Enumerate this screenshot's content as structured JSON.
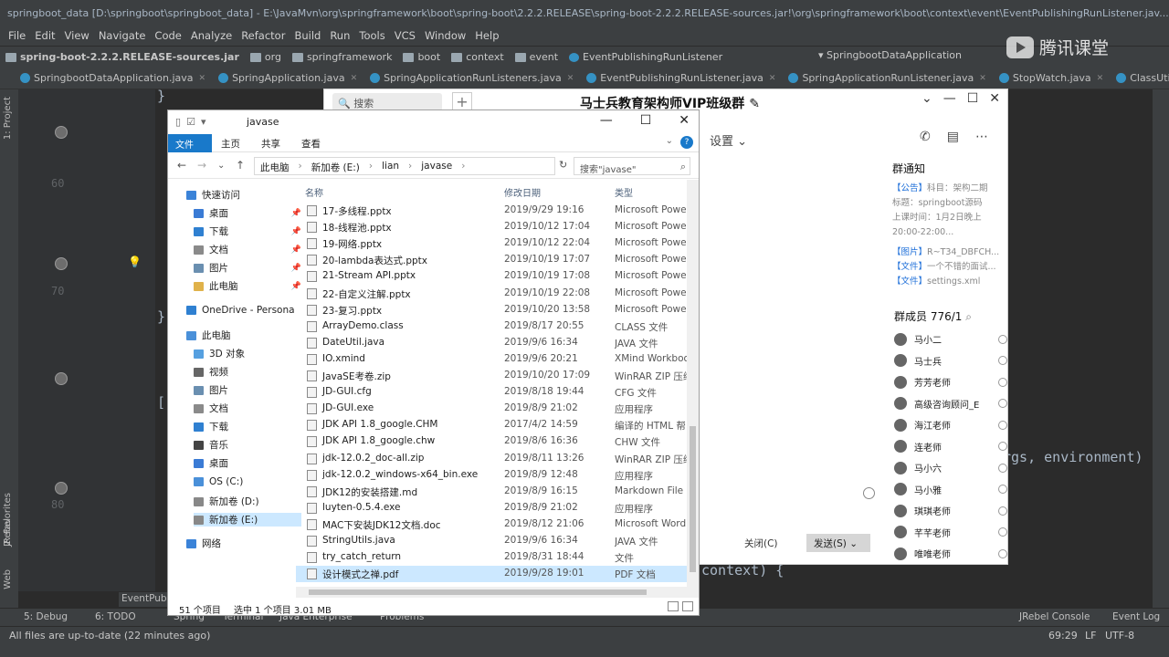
{
  "ide": {
    "title": "springboot_data [D:\\springboot\\springboot_data] - E:\\JavaMvn\\org\\springframework\\boot\\spring-boot\\2.2.2.RELEASE\\spring-boot-2.2.2.RELEASE-sources.jar!\\org\\springframework\\boot\\context\\event\\EventPublishingRunListener.jav...",
    "menu": [
      "File",
      "Edit",
      "View",
      "Navigate",
      "Code",
      "Analyze",
      "Refactor",
      "Build",
      "Run",
      "Tools",
      "VCS",
      "Window",
      "Help"
    ],
    "breadcrumbs": [
      "spring-boot-2.2.2.RELEASE-sources.jar",
      "org",
      "springframework",
      "boot",
      "context",
      "event",
      "EventPublishingRunListener"
    ],
    "run_config": "SpringbootDataApplication",
    "tabs": [
      "SpringbootDataApplication.java",
      "SpringApplication.java",
      "SpringApplicationRunListeners.java",
      "EventPublishingRunListener.java",
      "SpringApplicationRunListener.java",
      "StopWatch.java",
      "ClassUtils.java"
    ],
    "left_tools": [
      "1: Project",
      "JRebel",
      "2: Favorites",
      "Web"
    ],
    "code_fragments": [
      "}",
      "}",
      "[ {",
      "}",
      "}",
      "rgs,  environment)",
      "context)  {"
    ],
    "line_numbers": [
      "60",
      "70",
      "80"
    ],
    "debug_tab": "EventPubli",
    "bottom_tools": [
      "5: Debug",
      "6: TODO",
      "Spring",
      "Terminal",
      "Java Enterprise",
      "Problems",
      "JRebel Console",
      "Event Log"
    ],
    "status_text": "All files are up-to-date (22 minutes ago)",
    "cursor_pos": "69:29",
    "line_sep": "LF",
    "encoding": "UTF-8"
  },
  "watermark": {
    "brand": "腾讯课堂",
    "sub": "腾讯课堂"
  },
  "chat": {
    "search_placeholder": "搜索",
    "title": "马士兵教育架构师VIP班级群",
    "settings": "设置",
    "notice_title": "群通知",
    "notice_lines": [
      {
        "tag": "【公告】",
        "text": "科目：架构二期"
      },
      {
        "tag": "",
        "text": "标题：springboot源码"
      },
      {
        "tag": "",
        "text": "上课时间：1月2日晚上"
      },
      {
        "tag": "",
        "text": "20:00-22:00..."
      },
      {
        "tag": "【图片】",
        "text": "R~T34_DBFCH..."
      },
      {
        "tag": "【文件】",
        "text": "一个不错的面试..."
      },
      {
        "tag": "【文件】",
        "text": "settings.xml"
      }
    ],
    "members_label": "群成员 776/1",
    "members": [
      "马小二",
      "马士兵",
      "芳芳老师",
      "高级咨询顾问_E",
      "海江老师",
      "连老师",
      "马小六",
      "马小雅",
      "琪琪老师",
      "芊芊老师",
      "唯唯老师"
    ],
    "close_label": "关闭(C)",
    "send_label": "发送(S)"
  },
  "explorer": {
    "title": "javase",
    "ribbon": {
      "file": "文件",
      "home": "主页",
      "share": "共享",
      "view": "查看"
    },
    "address": [
      "此电脑",
      "新加卷 (E:)",
      "lian",
      "javase"
    ],
    "search_placeholder": "搜索\"javase\"",
    "nav": [
      {
        "label": "快速访问",
        "pin": false,
        "color": "#3b83d8"
      },
      {
        "label": "桌面",
        "pin": true,
        "color": "#3a7bd5"
      },
      {
        "label": "下载",
        "pin": true,
        "color": "#2f80d1"
      },
      {
        "label": "文档",
        "pin": true,
        "color": "#8a8a8a"
      },
      {
        "label": "图片",
        "pin": true,
        "color": "#6a8fb0"
      },
      {
        "label": "此电脑",
        "pin": true,
        "color": "#e0b24a"
      },
      {
        "label": "OneDrive - Persona",
        "pin": false,
        "color": "#2f80d1"
      },
      {
        "label": "此电脑",
        "pin": false,
        "color": "#4a90d9"
      },
      {
        "label": "3D 对象",
        "pin": false,
        "color": "#56a0e0"
      },
      {
        "label": "视频",
        "pin": false,
        "color": "#666666"
      },
      {
        "label": "图片",
        "pin": false,
        "color": "#6a8fb0"
      },
      {
        "label": "文档",
        "pin": false,
        "color": "#8a8a8a"
      },
      {
        "label": "下载",
        "pin": false,
        "color": "#2f80d1"
      },
      {
        "label": "音乐",
        "pin": false,
        "color": "#444444"
      },
      {
        "label": "桌面",
        "pin": false,
        "color": "#3a7bd5"
      },
      {
        "label": "OS (C:)",
        "pin": false,
        "color": "#4a90d9"
      },
      {
        "label": "新加卷 (D:)",
        "pin": false,
        "color": "#888888"
      },
      {
        "label": "新加卷 (E:)",
        "pin": false,
        "color": "#888888"
      },
      {
        "label": "网络",
        "pin": false,
        "color": "#3b83d8"
      }
    ],
    "columns": {
      "name": "名称",
      "date": "修改日期",
      "type": "类型"
    },
    "files": [
      {
        "name": "17-多线程.pptx",
        "date": "2019/9/29 19:16",
        "type": "Microsoft Powe"
      },
      {
        "name": "18-线程池.pptx",
        "date": "2019/10/12 17:04",
        "type": "Microsoft Powe"
      },
      {
        "name": "19-网络.pptx",
        "date": "2019/10/12 22:04",
        "type": "Microsoft Powe"
      },
      {
        "name": "20-lambda表达式.pptx",
        "date": "2019/10/19 17:07",
        "type": "Microsoft Powe"
      },
      {
        "name": "21-Stream API.pptx",
        "date": "2019/10/19 17:08",
        "type": "Microsoft Powe"
      },
      {
        "name": "22-自定义注解.pptx",
        "date": "2019/10/19 22:08",
        "type": "Microsoft Powe"
      },
      {
        "name": "23-复习.pptx",
        "date": "2019/10/20 13:58",
        "type": "Microsoft Powe"
      },
      {
        "name": "ArrayDemo.class",
        "date": "2019/8/17 20:55",
        "type": "CLASS 文件"
      },
      {
        "name": "DateUtil.java",
        "date": "2019/9/6 16:34",
        "type": "JAVA 文件"
      },
      {
        "name": "IO.xmind",
        "date": "2019/9/6 20:21",
        "type": "XMind Workboo"
      },
      {
        "name": "JavaSE考卷.zip",
        "date": "2019/10/20 17:09",
        "type": "WinRAR ZIP 压缩"
      },
      {
        "name": "JD-GUI.cfg",
        "date": "2019/8/18 19:44",
        "type": "CFG 文件"
      },
      {
        "name": "JD-GUI.exe",
        "date": "2019/8/9 21:02",
        "type": "应用程序"
      },
      {
        "name": "JDK API 1.8_google.CHM",
        "date": "2017/4/2 14:59",
        "type": "编译的 HTML 帮"
      },
      {
        "name": "JDK API 1.8_google.chw",
        "date": "2019/8/6 16:36",
        "type": "CHW 文件"
      },
      {
        "name": "jdk-12.0.2_doc-all.zip",
        "date": "2019/8/11 13:26",
        "type": "WinRAR ZIP 压缩"
      },
      {
        "name": "jdk-12.0.2_windows-x64_bin.exe",
        "date": "2019/8/9 12:48",
        "type": "应用程序"
      },
      {
        "name": "JDK12的安装搭建.md",
        "date": "2019/8/9 16:15",
        "type": "Markdown File"
      },
      {
        "name": "luyten-0.5.4.exe",
        "date": "2019/8/9 21:02",
        "type": "应用程序"
      },
      {
        "name": "MAC下安装JDK12文档.doc",
        "date": "2019/8/12 21:06",
        "type": "Microsoft Word"
      },
      {
        "name": "StringUtils.java",
        "date": "2019/9/6 16:34",
        "type": "JAVA 文件"
      },
      {
        "name": "try_catch_return",
        "date": "2019/8/31 18:44",
        "type": "文件"
      },
      {
        "name": "设计模式之禅.pdf",
        "date": "2019/9/28 19:01",
        "type": "PDF 文档"
      }
    ],
    "status_count": "51 个项目",
    "status_selected": "选中 1 个项目  3.01 MB"
  }
}
